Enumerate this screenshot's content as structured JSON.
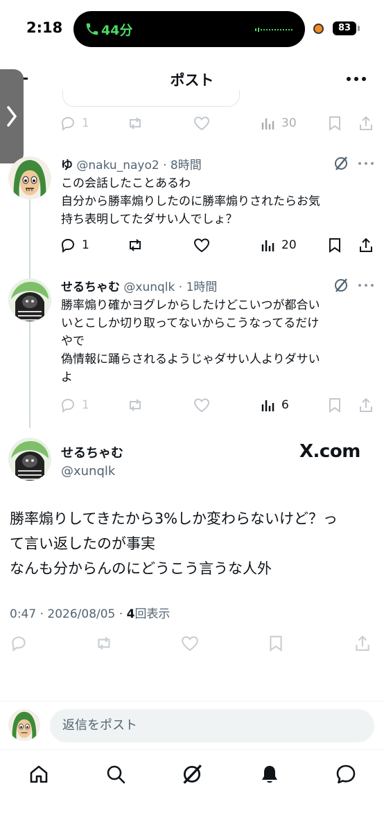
{
  "status": {
    "time": "2:18",
    "call_duration": "44分",
    "battery": "83"
  },
  "header": {
    "title": "ポスト"
  },
  "prev_actions": {
    "replies": "1",
    "views": "30"
  },
  "replies": [
    {
      "name": "ゆ",
      "handle": "@naku_nayo2",
      "time": "8時間",
      "lines": [
        "この会話したことあるわ",
        "自分から勝率煽りしたのに勝率煽りされたらお気",
        "持ち表明してたダサい人でしょ？"
      ],
      "reply_count": "1",
      "views": "20"
    },
    {
      "name": "せるちゃむ",
      "handle": "@xunqlk",
      "time": "1時間",
      "lines": [
        "勝率煽り確かヨグレからしたけどこいつが都合い",
        "いとこしか切り取ってないからこうなってるだけ",
        "やで",
        "偽情報に踊らされるようじゃダサい人よりダサい",
        "よ"
      ],
      "reply_count": "1",
      "views": "6"
    }
  ],
  "main_post": {
    "name": "せるちゃむ",
    "handle": "@xunqlk",
    "watermark": "X.com",
    "lines": [
      "勝率煽りしてきたから3%しか変わらないけど？っ",
      "て言い返したのが事実",
      "なんも分からんのにどうこう言うな人外"
    ],
    "timestamp": "0:47 · 2026/08/05 · ",
    "views_count": "4",
    "views_label": "回表示"
  },
  "compose": {
    "placeholder": "返信をポスト"
  },
  "tabbar": {
    "items": [
      "home-icon",
      "search-icon",
      "grok-icon",
      "notifications-icon",
      "messages-icon"
    ]
  },
  "colors": {
    "text": "#0f1419",
    "muted": "#536471",
    "call_green": "#4cd964",
    "accent_orange": "#f08a24"
  }
}
